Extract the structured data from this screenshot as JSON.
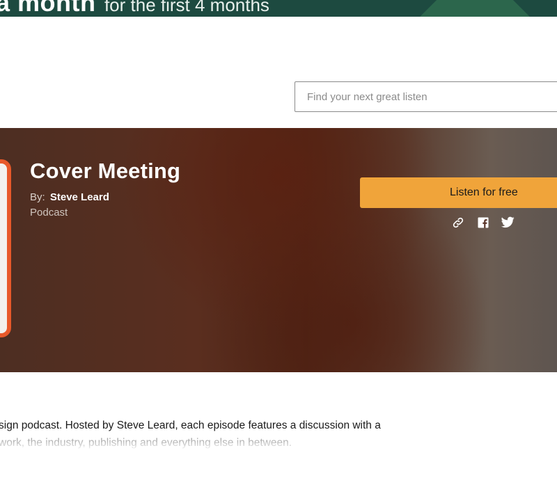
{
  "promo": {
    "headline": "a month",
    "subtext": "for the first 4 months"
  },
  "search": {
    "placeholder": "Find your next great listen"
  },
  "podcast": {
    "title": "Cover Meeting",
    "by_label": "By:",
    "author": "Steve Leard",
    "category": "Podcast",
    "listen_label": "Listen for free"
  },
  "share": {
    "icons": [
      "link-icon",
      "facebook-icon",
      "twitter-icon"
    ]
  },
  "description": {
    "line1": "sign podcast. Hosted by Steve Leard, each episode features a discussion with a",
    "line2": " work, the industry, publishing and everything else in between."
  },
  "colors": {
    "promo_bg": "#1d4a40",
    "hero_bg": "#5a2e1f",
    "listen_button": "#f0a43a",
    "cover_accent": "#e8592a"
  }
}
